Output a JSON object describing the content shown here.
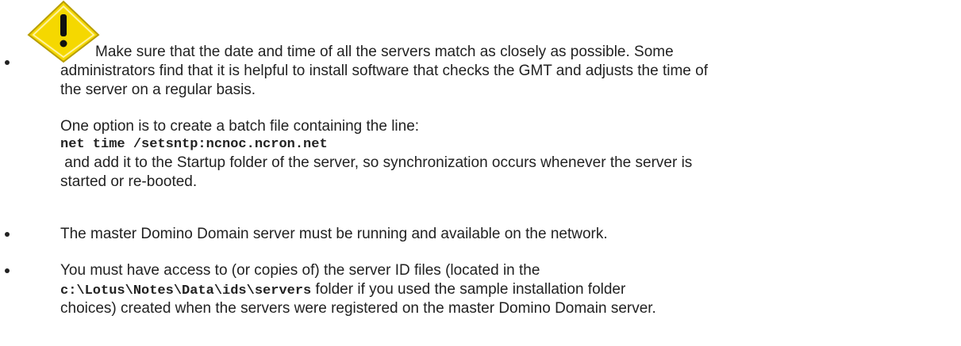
{
  "colors": {
    "text": "#222222",
    "warning_fill": "#F5D800",
    "warning_border": "#B89E00",
    "warning_mark": "#111111"
  },
  "items": [
    {
      "icon": "warning-icon",
      "lines": [
        "Make sure that the date and time of all the servers match as closely as possible. Some",
        "administrators find that it is helpful to install software that checks the GMT and adjusts the time of",
        "the server on a regular basis."
      ],
      "para2_intro": "One option is to create a batch file containing the line:",
      "command": "net time /setsntp:ncnoc.ncron.net",
      "para2_lines": [
        " and add it to the Startup folder of the server, so synchronization occurs whenever the server is",
        "started or re-booted."
      ]
    },
    {
      "text": "The master Domino Domain server must be running and available on the network."
    },
    {
      "line1": "You must have access to (or copies of) the server ID files (located in the",
      "path": "c:\\Lotus\\Notes\\Data\\ids\\servers",
      "line2_rest": " folder if you used the sample installation folder",
      "line3": "choices) created when the servers were registered on the master Domino Domain server."
    }
  ]
}
